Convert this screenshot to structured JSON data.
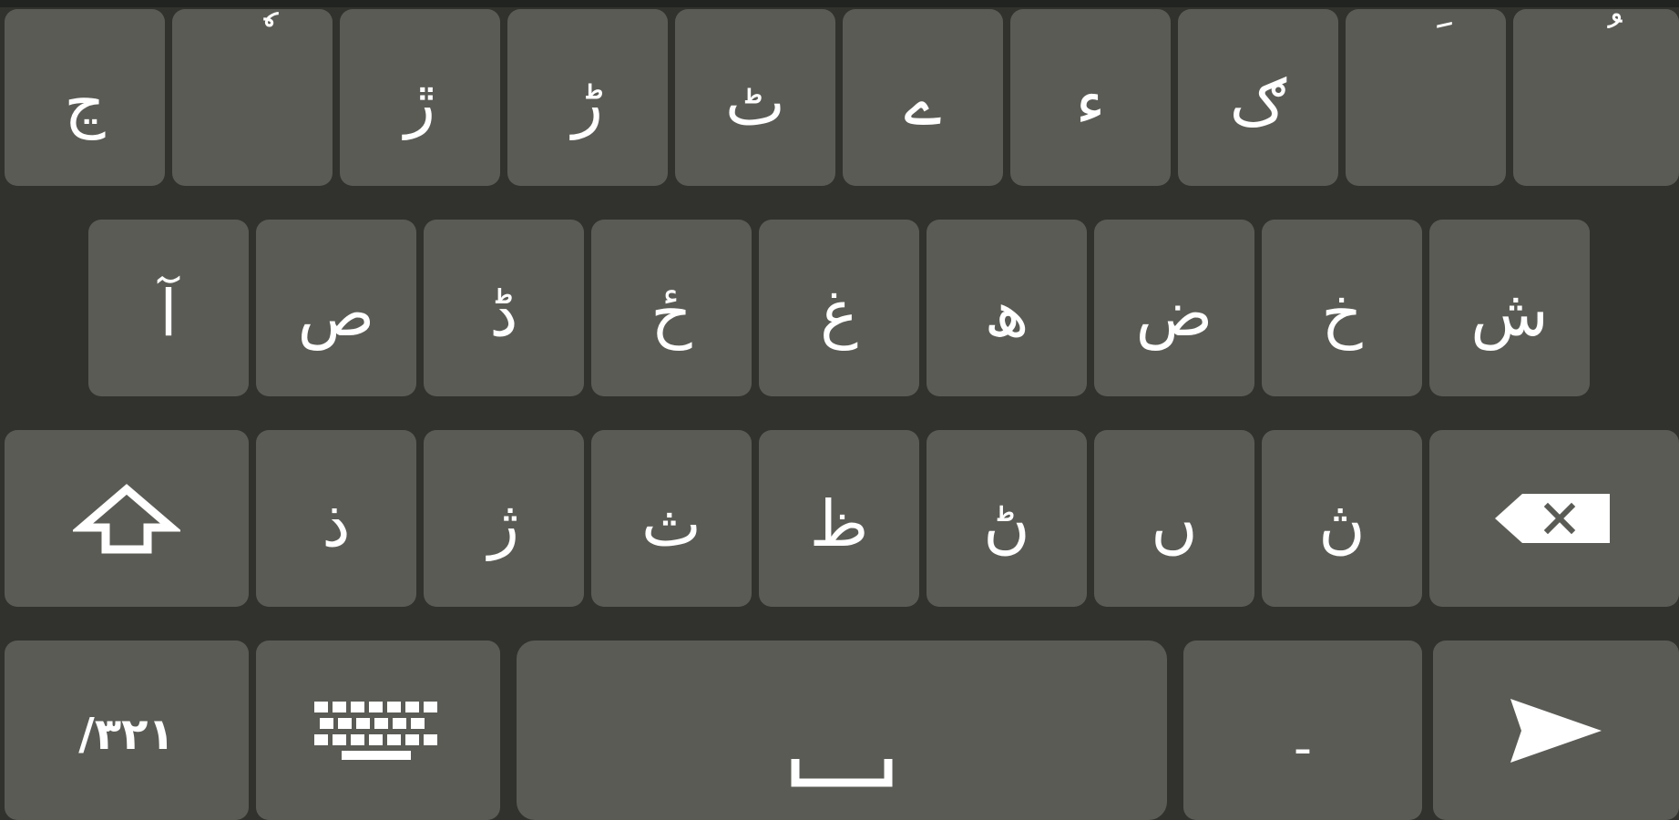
{
  "keyboard": {
    "row1": [
      {
        "label": "ڃ",
        "name": "key-cheh"
      },
      {
        "label": "ٗ",
        "name": "key-diacritic-inverted-damma"
      },
      {
        "label": "ڙ",
        "name": "key-rreh-dot"
      },
      {
        "label": "ڑ",
        "name": "key-rreh"
      },
      {
        "label": "ٹ",
        "name": "key-tteh"
      },
      {
        "label": "ے",
        "name": "key-yeh-barree"
      },
      {
        "label": "ء",
        "name": "key-hamza"
      },
      {
        "label": "ګ",
        "name": "key-gaf-ring"
      },
      {
        "label": "َ",
        "name": "key-diacritic-fatha"
      },
      {
        "label": "ُ",
        "name": "key-diacritic-damma"
      }
    ],
    "row2": [
      {
        "label": "آ",
        "name": "key-alef-madda"
      },
      {
        "label": "ص",
        "name": "key-sad"
      },
      {
        "label": "ڈ",
        "name": "key-ddal"
      },
      {
        "label": "ځ",
        "name": "key-hah-hamza"
      },
      {
        "label": "غ",
        "name": "key-ghain"
      },
      {
        "label": "ھ",
        "name": "key-heh-doachashmee"
      },
      {
        "label": "ض",
        "name": "key-dad"
      },
      {
        "label": "خ",
        "name": "key-khah"
      },
      {
        "label": "ش",
        "name": "key-sheen"
      }
    ],
    "row3": [
      {
        "label": "ذ",
        "name": "key-thal"
      },
      {
        "label": "ژ",
        "name": "key-jeh"
      },
      {
        "label": "ث",
        "name": "key-theh"
      },
      {
        "label": "ظ",
        "name": "key-zah"
      },
      {
        "label": "ڻ",
        "name": "key-rnoon"
      },
      {
        "label": "ں",
        "name": "key-noon-ghunna"
      },
      {
        "label": "ڽ",
        "name": "key-noon-v"
      }
    ],
    "row4": {
      "numbers_label": "/۳۲۱",
      "dash_label": "-"
    },
    "colors": {
      "background": "#31322d",
      "key": "#5b5b56",
      "text": "#ffffff"
    },
    "icons": {
      "shift": "shift-arrow-icon",
      "backspace": "backspace-icon",
      "keyboard": "keyboard-icon",
      "space": "space-bar-icon",
      "send": "send-arrow-icon"
    }
  }
}
